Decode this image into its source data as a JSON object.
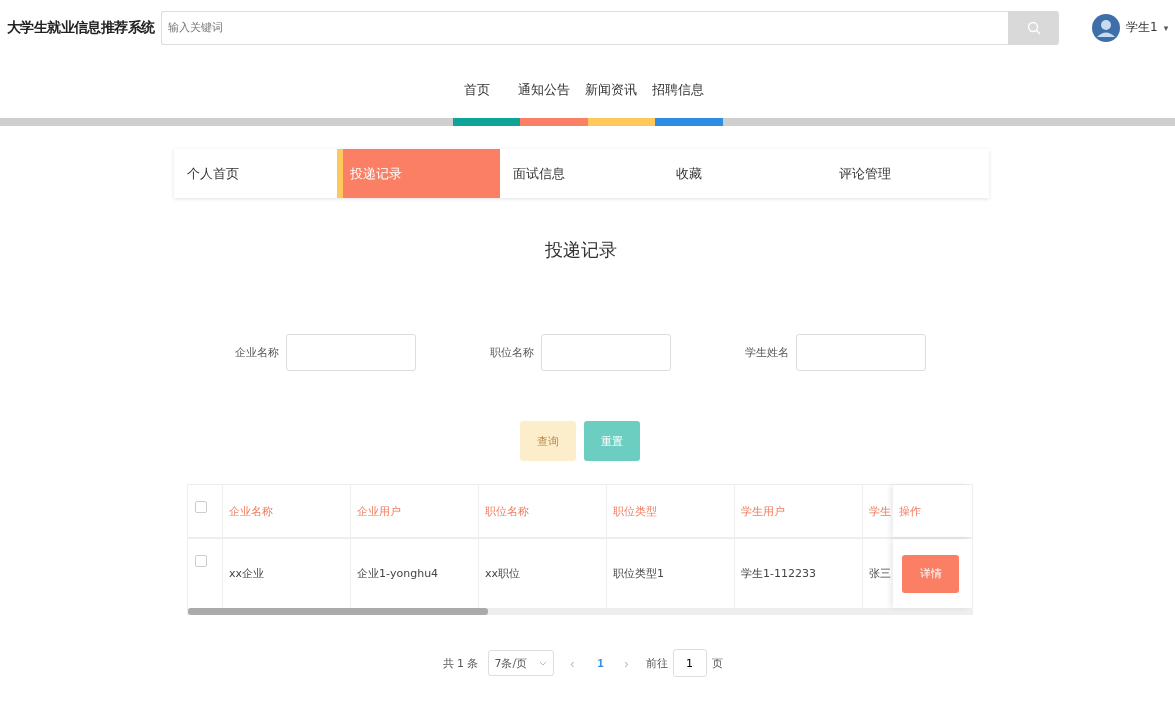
{
  "header": {
    "title": "大学生就业信息推荐系统",
    "search": {
      "placeholder": "输入关键词"
    },
    "user": {
      "name": "学生1",
      "caret": "▾"
    }
  },
  "nav": [
    {
      "label": "首页",
      "color": "#0fa39a"
    },
    {
      "label": "通知公告",
      "color": "#fa7f64"
    },
    {
      "label": "新闻资讯",
      "color": "#fdc95c"
    },
    {
      "label": "招聘信息",
      "color": "#2e8de3"
    }
  ],
  "tabs": [
    {
      "label": "个人首页",
      "selected": false
    },
    {
      "label": "投递记录",
      "selected": true
    },
    {
      "label": "面试信息",
      "selected": false
    },
    {
      "label": "收藏",
      "selected": false
    },
    {
      "label": "评论管理",
      "selected": false
    }
  ],
  "page_title": "投递记录",
  "filters": [
    {
      "label": "企业名称"
    },
    {
      "label": "职位名称"
    },
    {
      "label": "学生姓名"
    }
  ],
  "buttons": [
    {
      "label": "查询",
      "kind": "query"
    },
    {
      "label": "重置",
      "kind": "reset"
    }
  ],
  "table": {
    "columns": [
      "企业名称",
      "企业用户",
      "职位名称",
      "职位类型",
      "学生用户",
      "学生"
    ],
    "action_column": "操作",
    "all_checked": false,
    "rows": [
      {
        "checked": false,
        "cells": [
          "xx企业",
          "企业1-yonghu4",
          "xx职位",
          "职位类型1",
          "学生1-112233",
          "张三"
        ],
        "action": "详情"
      }
    ]
  },
  "pagination": {
    "total": "共 1 条",
    "page_size": "7条/页",
    "prev": "‹",
    "page": "1",
    "next": "›",
    "goto_label": "前往",
    "goto_value": "1",
    "page_label": "页"
  }
}
